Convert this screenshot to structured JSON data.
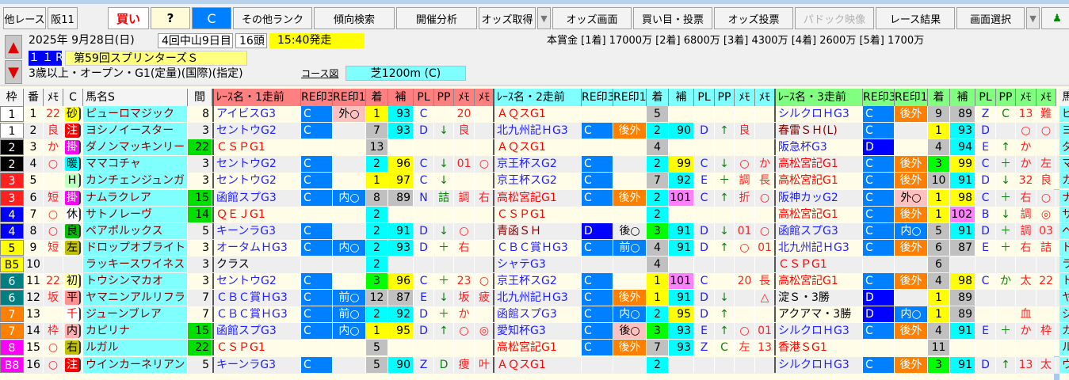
{
  "toolbar": {
    "other_race": "他レース",
    "race_code": "阪11",
    "buy": "買い",
    "question": "?",
    "rank_c": "C",
    "other_rank": "その他ランク",
    "trend_search": "傾向検索",
    "meeting_analysis": "開催分析",
    "odds_fetch": "オッズ取得",
    "odds_screen": "オッズ画面",
    "bet_vote": "買い目・投票",
    "odds_vote": "オッズ投票",
    "paddock_video": "パドック映像",
    "race_result": "レース結果",
    "screen_select": "画面選択"
  },
  "info": {
    "date": "2025年 9月28日(日)",
    "meeting": "4回中山9日目",
    "runners": "16頭",
    "start_time": "15:40発走",
    "race_no": "１１R",
    "race_name": "第59回スプリンターズＳ",
    "conditions": "3歳以上・オープン・G1(定量)(国際)(指定)",
    "course_map": "コース図",
    "course": "芝1200m (C)",
    "prize": "本賞金 [1着] 17000万 [2着] 6800万 [3着] 4300万 [4着] 2600万 [5着] 1700万"
  },
  "colors": {
    "accent": "#0080ff",
    "name_bg": "#80ffff",
    "race1_header": "#ff8080",
    "race2_header": "#80ffff",
    "race3_header": "#80ff80"
  },
  "headers": {
    "waku": "枠",
    "ban": "番",
    "memo": "ﾒﾓ",
    "c": "C",
    "name": "馬名S",
    "interval": "間",
    "race1": "ﾚｰｽ名・1走前",
    "race2": "ﾚｰｽ名・2走前",
    "race3": "ﾚｰｽ名・3走前",
    "re3": "RE印3",
    "re1": "RE印1",
    "chaku": "着",
    "ho": "補",
    "pl": "PL",
    "pp": "PP",
    "m1": "ﾒﾓ",
    "m2": "ﾒﾓ",
    "name2": "馬"
  },
  "rows": [
    {
      "waku": "1",
      "ban": "1",
      "memo": "22",
      "badge": [
        "砂",
        "#ffff00",
        "#000"
      ],
      "name": "ピューロマジック",
      "interval": "8",
      "r": [
        [
          "アイビスG3",
          "b",
          "C",
          "外○",
          "pink",
          "1",
          "93",
          "C",
          "",
          "20",
          ""
        ],
        [
          "ＡＱスG1",
          "r",
          "",
          "",
          "",
          "5",
          "",
          "",
          "",
          "",
          ""
        ],
        [
          "シルクロＨG3",
          "b",
          "C",
          "後外",
          "orange",
          "9",
          "89",
          "Z",
          "C",
          "13",
          "難"
        ]
      ]
    },
    {
      "waku": "1",
      "ban": "2",
      "memo": "良",
      "badge": [
        "注",
        "#ff0000",
        "#fff"
      ],
      "name": "ヨシノイースター",
      "interval": "3",
      "r": [
        [
          "セントウG2",
          "b",
          "C",
          "",
          "",
          "7",
          "93",
          "D",
          "↓",
          "良",
          ""
        ],
        [
          "北九州記ＨG3",
          "b",
          "C",
          "後外",
          "orange",
          "2",
          "90",
          "D",
          "↑",
          "良",
          ""
        ],
        [
          "春雷ＳＨ(L)",
          "m",
          "C",
          "",
          "",
          "1",
          "93",
          "D",
          "",
          "○",
          "○"
        ]
      ]
    },
    {
      "waku": "2",
      "ban": "3",
      "memo": "か",
      "badge": [
        "掛",
        "#ff00ff",
        "#fff"
      ],
      "name": "ダノンマッキンリー",
      "interval": "22",
      "r": [
        [
          "ＣＳＰG1",
          "r",
          "",
          "",
          "",
          "13",
          "",
          "",
          "",
          "",
          ""
        ],
        [
          "ＡＱスG1",
          "r",
          "",
          "",
          "",
          "4",
          "",
          "",
          "",
          "",
          ""
        ],
        [
          "阪急杯G3",
          "b",
          "D",
          "",
          "",
          "4",
          "94",
          "E",
          "↑",
          "か",
          ""
        ]
      ]
    },
    {
      "waku": "2",
      "ban": "4",
      "memo": "○",
      "badge": [
        "暖",
        "#00ffff",
        "#000"
      ],
      "name": "ママコチャ",
      "interval": "3",
      "r": [
        [
          "セントウG2",
          "b",
          "C",
          "",
          "",
          "2",
          "96",
          "C",
          "↓",
          "01",
          "○"
        ],
        [
          "京王杯スG2",
          "b",
          "C",
          "",
          "",
          "2",
          "99",
          "C",
          "↓",
          "○",
          "か"
        ],
        [
          "高松宮記G1",
          "r",
          "C",
          "後外",
          "orange",
          "3",
          "99",
          "C",
          "＋",
          "か",
          "左"
        ]
      ]
    },
    {
      "waku": "3",
      "ban": "5",
      "memo": "",
      "badge": [
        "H",
        "#c0ffc0",
        "#000"
      ],
      "name": "カンチェンジュンガ",
      "interval": "3",
      "r": [
        [
          "セントウG2",
          "b",
          "C",
          "",
          "",
          "1",
          "97",
          "C",
          "↓",
          "",
          ""
        ],
        [
          "京王杯スG2",
          "b",
          "C",
          "",
          "",
          "7",
          "92",
          "E",
          "＋",
          "調",
          "長"
        ],
        [
          "高松宮記G1",
          "r",
          "C",
          "後外",
          "orange",
          "10",
          "91",
          "D",
          "↓",
          "32",
          "良"
        ]
      ]
    },
    {
      "waku": "3",
      "ban": "6",
      "memo": "短",
      "badge": [
        "掛",
        "#ff00ff",
        "#fff"
      ],
      "name": "ナムラクレア",
      "interval": "15",
      "r": [
        [
          "函館スプG3",
          "b",
          "C",
          "内○",
          "blue",
          "8",
          "89",
          "N",
          "詰",
          "調",
          "右"
        ],
        [
          "高松宮記G1",
          "r",
          "C",
          "後外",
          "orange",
          "2",
          "101",
          "C",
          "↑",
          "折",
          "○"
        ],
        [
          "阪神カッG2",
          "b",
          "C",
          "外○",
          "pink",
          "1",
          "98",
          "C",
          "＋",
          "右",
          "○"
        ]
      ]
    },
    {
      "waku": "4",
      "ban": "7",
      "memo": "○",
      "badge": [
        "休",
        "#ffffff",
        "#000"
      ],
      "name": "サトノレーヴ",
      "interval": "14",
      "r": [
        [
          "ＱＥＪG1",
          "r",
          "",
          "",
          "",
          "2",
          "",
          "",
          "",
          "",
          ""
        ],
        [
          "ＣＳＰG1",
          "r",
          "",
          "",
          "",
          "2",
          "",
          "",
          "",
          "",
          ""
        ],
        [
          "高松宮記G1",
          "r",
          "C",
          "後外",
          "orange",
          "1",
          "102",
          "B",
          "↓",
          "調",
          "◎"
        ]
      ]
    },
    {
      "waku": "4",
      "ban": "8",
      "memo": "○",
      "badge": [
        "良",
        "#00c000",
        "#000"
      ],
      "name": "ペアポルックス",
      "interval": "5",
      "r": [
        [
          "キーンラG3",
          "b",
          "C",
          "",
          "",
          "2",
          "91",
          "D",
          "↓",
          "○",
          ""
        ],
        [
          "青函ＳＨ",
          "m",
          "D",
          "後○",
          "",
          "3",
          "91",
          "D",
          "↓",
          "01",
          "○"
        ],
        [
          "函館スプG3",
          "b",
          "C",
          "内○",
          "blue",
          "5",
          "91",
          "D",
          "＋",
          "調",
          "03"
        ]
      ]
    },
    {
      "waku": "5",
      "ban": "9",
      "memo": "短",
      "badge": [
        "左",
        "#c0c000",
        "#000"
      ],
      "name": "ドロップオブライト",
      "interval": "3",
      "r": [
        [
          "オータムＨG3",
          "b",
          "C",
          "内○",
          "blue",
          "2",
          "93",
          "D",
          "＋",
          "右",
          ""
        ],
        [
          "ＣＢＣ賞ＨG3",
          "b",
          "C",
          "前○",
          "blue",
          "4",
          "91",
          "D",
          "↑",
          "○",
          "01"
        ],
        [
          "北九州記ＨG3",
          "b",
          "C",
          "後外",
          "orange",
          "6",
          "87",
          "E",
          "＋",
          "右",
          "詰"
        ]
      ]
    },
    {
      "waku": "B5",
      "ban": "10",
      "memo": "",
      "badge": [
        "",
        "",
        ""
      ],
      "name": "ラッキースワイネス",
      "interval": "3",
      "r": [
        [
          "クラス",
          "k",
          "",
          "",
          "",
          "2",
          "",
          "",
          "",
          "",
          ""
        ],
        [
          "シャテG3",
          "b",
          "",
          "",
          "",
          "4",
          "",
          "",
          "",
          "",
          ""
        ],
        [
          "ＣＳＰG1",
          "r",
          "",
          "",
          "",
          "6",
          "",
          "",
          "",
          "",
          ""
        ]
      ]
    },
    {
      "waku": "6",
      "ban": "11",
      "memo": "22",
      "badge": [
        "初",
        "#ffffa0",
        "#000"
      ],
      "name": "トウシンマカオ",
      "interval": "3",
      "r": [
        [
          "セントウG2",
          "b",
          "C",
          "",
          "",
          "3",
          "96",
          "C",
          "＋",
          "23",
          "○"
        ],
        [
          "京王杯スG2",
          "b",
          "C",
          "",
          "",
          "1",
          "101",
          "C",
          "",
          "20",
          "長"
        ],
        [
          "高松宮記G1",
          "r",
          "C",
          "後外",
          "orange",
          "4",
          "98",
          "C",
          "か",
          "太",
          "22"
        ]
      ]
    },
    {
      "waku": "6",
      "ban": "12",
      "memo": "坂",
      "badge": [
        "平",
        "#ff9090",
        "#000"
      ],
      "name": "ヤマニンアルリフラ",
      "interval": "7",
      "r": [
        [
          "ＣＢＣ賞ＨG3",
          "b",
          "C",
          "前○",
          "blue",
          "12",
          "87",
          "E",
          "↓",
          "坂",
          "疲"
        ],
        [
          "北九州記ＨG3",
          "b",
          "C",
          "後外",
          "orange",
          "1",
          "91",
          "D",
          "↓",
          "",
          "△"
        ],
        [
          "淀Ｓ・3勝",
          "k",
          "D",
          "",
          "",
          "1",
          "89",
          "",
          "",
          "",
          ""
        ]
      ]
    },
    {
      "waku": "7",
      "ban": "13",
      "memo": "",
      "badge": [
        "千",
        "#ffffff",
        "#f00"
      ],
      "name": "ジューンブレア",
      "interval": "7",
      "r": [
        [
          "ＣＢＣ賞ＨG3",
          "b",
          "C",
          "前○",
          "blue",
          "2",
          "92",
          "D",
          "＋",
          "か",
          ""
        ],
        [
          "函館スプG3",
          "b",
          "C",
          "内○",
          "blue",
          "2",
          "95",
          "D",
          "↑",
          "",
          ""
        ],
        [
          "アクアマ・3勝",
          "k",
          "D",
          "内○",
          "blue",
          "1",
          "89",
          "",
          "",
          "血",
          ""
        ]
      ]
    },
    {
      "waku": "7",
      "ban": "14",
      "memo": "枠",
      "badge": [
        "内",
        "#ffb0b0",
        "#000"
      ],
      "name": "カピリナ",
      "interval": "15",
      "r": [
        [
          "函館スプG3",
          "b",
          "C",
          "内○",
          "blue",
          "1",
          "95",
          "D",
          "↑",
          "○",
          "◎"
        ],
        [
          "愛知杯G3",
          "b",
          "C",
          "後○",
          "pink",
          "3",
          "93",
          "E",
          "↑",
          "○",
          "01"
        ],
        [
          "シルクロＨG3",
          "b",
          "C",
          "後外",
          "orange",
          "4",
          "91",
          "E",
          "＋",
          "か",
          "枠"
        ]
      ]
    },
    {
      "waku": "8",
      "ban": "15",
      "memo": "○",
      "badge": [
        "右",
        "#c0c000",
        "#000"
      ],
      "name": "ルガル",
      "interval": "22",
      "r": [
        [
          "ＣＳＰG1",
          "r",
          "",
          "",
          "",
          "5",
          "",
          "",
          "",
          "",
          ""
        ],
        [
          "高松宮記G1",
          "r",
          "C",
          "後外",
          "orange",
          "7",
          "93",
          "Z",
          "C",
          "左",
          "13"
        ],
        [
          "香港ＳG1",
          "r",
          "",
          "",
          "",
          "11",
          "",
          "",
          "",
          "",
          ""
        ]
      ]
    },
    {
      "waku": "B8",
      "ban": "16",
      "memo": "○",
      "badge": [
        "注",
        "#ff0000",
        "#fff"
      ],
      "name": "ウインカーネリアン",
      "interval": "5",
      "r": [
        [
          "キーンラG3",
          "b",
          "C",
          "",
          "",
          "5",
          "90",
          "Z",
          "D",
          "痩",
          "叶"
        ],
        [
          "ＡＱスG1",
          "r",
          "",
          "",
          "",
          "2",
          "",
          "",
          "",
          "",
          ""
        ],
        [
          "シルクロＨG3",
          "b",
          "C",
          "後外",
          "orange",
          "3",
          "91",
          "D",
          "↑",
          "13",
          "太"
        ]
      ]
    }
  ]
}
